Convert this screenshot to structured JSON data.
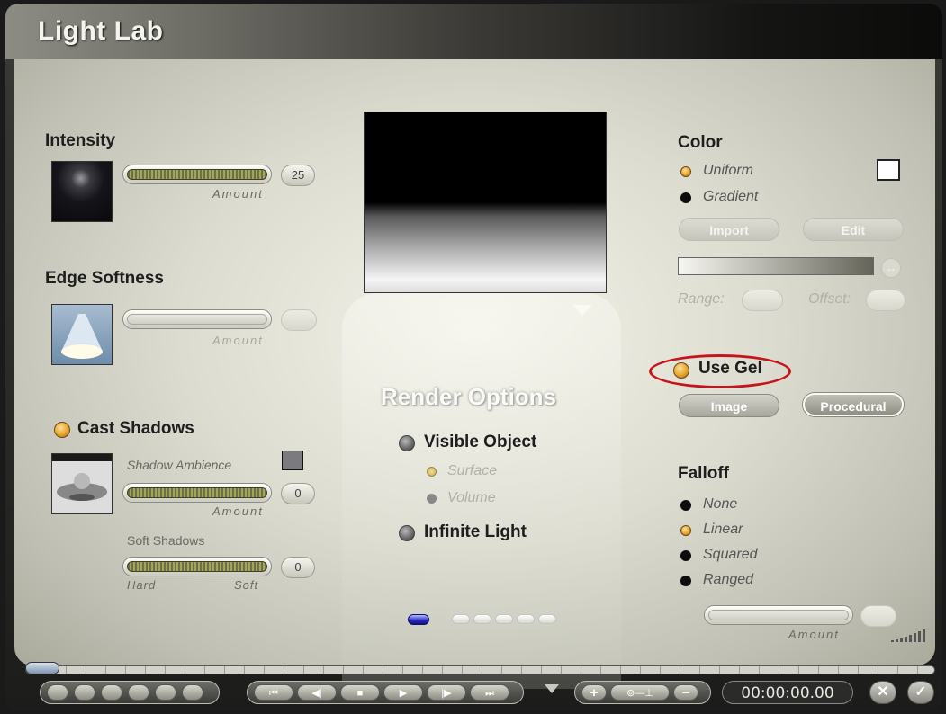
{
  "window": {
    "title": "Light Lab"
  },
  "intensity": {
    "title": "Intensity",
    "amount_label": "Amount",
    "value": "25",
    "level_fraction": 0.25
  },
  "edge_softness": {
    "title": "Edge Softness",
    "amount_label": "Amount",
    "value": ""
  },
  "shadows": {
    "title": "Cast Shadows",
    "ambience_label": "Shadow Ambience",
    "ambience_amount_label": "Amount",
    "ambience_value": "0",
    "ambience_color": "#7b7b7f",
    "soft_label": "Soft Shadows",
    "soft_value": "0",
    "hard_label": "Hard",
    "soft_end_label": "Soft"
  },
  "render_options": {
    "title": "Render Options",
    "visible_object": "Visible Object",
    "surface": "Surface",
    "volume": "Volume",
    "infinite_light": "Infinite Light"
  },
  "color": {
    "title": "Color",
    "uniform": "Uniform",
    "gradient": "Gradient",
    "import_label": "Import",
    "edit_label": "Edit",
    "range_label": "Range:",
    "offset_label": "Offset:",
    "swatch": "#ffffff"
  },
  "gel": {
    "title": "Use Gel",
    "image_label": "Image",
    "procedural_label": "Procedural",
    "highlight_color": "#c6141b"
  },
  "falloff": {
    "title": "Falloff",
    "options": [
      "None",
      "Linear",
      "Squared",
      "Ranged"
    ],
    "selected": "Linear",
    "amount_label": "Amount"
  },
  "pager": {
    "pages": 5,
    "active": 0
  },
  "timeline": {
    "timecode": "00:00:00.00"
  }
}
